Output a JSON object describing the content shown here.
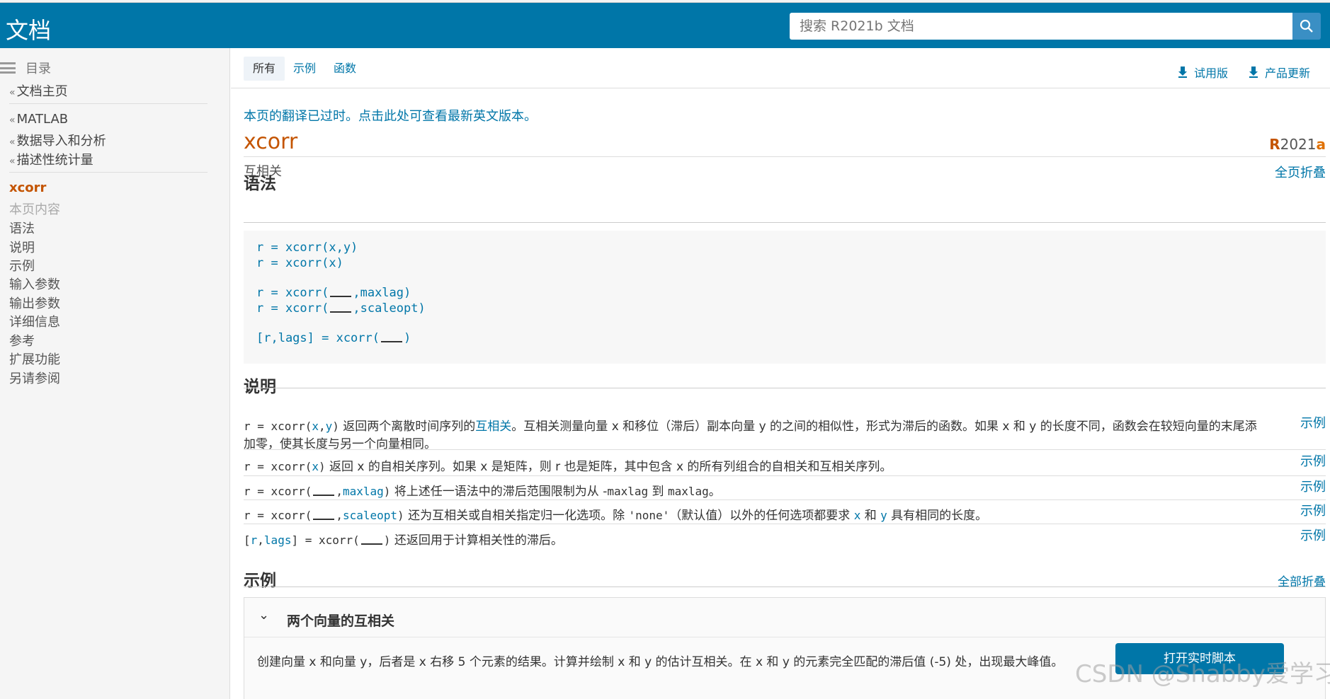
{
  "header": {
    "brand": "文档",
    "search_placeholder": "搜索 R2021b 文档"
  },
  "sidebar": {
    "toc_label": "目录",
    "home": "文档主页",
    "breadcrumb": [
      "MATLAB",
      "数据导入和分析",
      "描述性统计量"
    ],
    "current": "xcorr",
    "on_this_page": "本页内容",
    "items": [
      "语法",
      "说明",
      "示例",
      "输入参数",
      "输出参数",
      "详细信息",
      "参考",
      "扩展功能",
      "另请参阅"
    ]
  },
  "tabs": [
    "所有",
    "示例",
    "函数"
  ],
  "downloads": {
    "trial": "试用版",
    "updates": "产品更新"
  },
  "page": {
    "notice": "本页的翻译已过时。点击此处可查看最新英文版本。",
    "title": "xcorr",
    "subtitle": "互相关",
    "release_r": "R",
    "release_num": "2021",
    "release_a": "a",
    "collapse_page": "全页折叠"
  },
  "syntax": {
    "heading": "语法",
    "lines": [
      {
        "pre": "r = xcorr(x,y)",
        "post": ""
      },
      {
        "pre": "r = xcorr(x)",
        "post": ""
      },
      {
        "pre": "r = xcorr(",
        "post": ",maxlag)"
      },
      {
        "pre": "r = xcorr(",
        "post": ",scaleopt)"
      },
      {
        "pre": "[r,lags] = xcorr(",
        "post": ")"
      }
    ]
  },
  "description": {
    "heading": "说明",
    "example_link": "示例",
    "d1_a": "r = xcorr(",
    "d1_b": "x",
    "d1_c": ",",
    "d1_d": "y",
    "d1_e": ")",
    "d1_text1": " 返回两个离散时间序列的",
    "d1_link": "互相关",
    "d1_text2": "。互相关测量向量 x 和移位（滞后）副本向量 y 的之间的相似性，形式为滞后的函数。如果 x 和 y 的长度不同，函数会在较短向量的末尾添加零，使其长度与另一个向量相同。",
    "d2_a": "r = xcorr(",
    "d2_b": "x",
    "d2_c": ")",
    "d2_text": " 返回 x 的自相关序列。如果 x 是矩阵，则 r 也是矩阵，其中包含 x 的所有列组合的自相关和互相关序列。",
    "d3_a": "r = xcorr(",
    "d3_b": ",",
    "d3_c": "maxlag",
    "d3_d": ")",
    "d3_text1": " 将上述任一语法中的滞后范围限制为从 -",
    "d3_m1": "maxlag",
    "d3_text2": " 到 ",
    "d3_m2": "maxlag",
    "d3_text3": "。",
    "d4_a": "r = xcorr(",
    "d4_b": ",",
    "d4_c": "scaleopt",
    "d4_d": ")",
    "d4_text1": " 还为互相关或自相关指定归一化选项。除 ",
    "d4_none": "'none'",
    "d4_text2": "（默认值）以外的任何选项都要求 ",
    "d4_x": "x",
    "d4_text3": " 和 ",
    "d4_y": "y",
    "d4_text4": " 具有相同的长度。",
    "d5_a": "[",
    "d5_b": "r",
    "d5_c": ",",
    "d5_d": "lags",
    "d5_e": "] = xcorr(",
    "d5_f": ")",
    "d5_text": " 还返回用于计算相关性的滞后。"
  },
  "examples": {
    "heading": "示例",
    "collapse_all": "全部折叠",
    "ex1_title": "两个向量的互相关",
    "ex1_desc": "创建向量 x 和向量 y，后者是 x 右移 5 个元素的结果。计算并绘制 x 和 y 的估计互相关。在 x 和 y 的元素完全匹配的滞后值 (-5) 处，出现最大峰值。",
    "live_script": "打开实时脚本"
  },
  "watermark": "CSDN @Shabby爱学习"
}
